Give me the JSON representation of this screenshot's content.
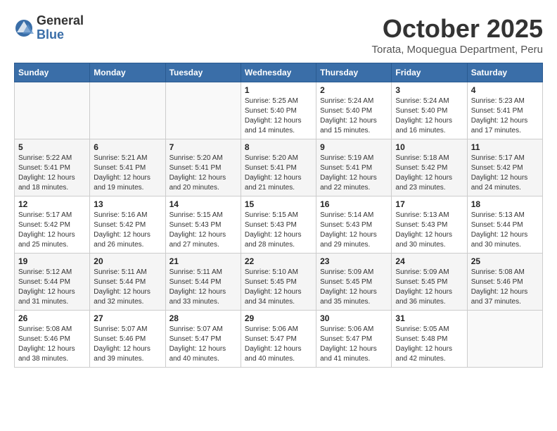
{
  "logo": {
    "general": "General",
    "blue": "Blue"
  },
  "header": {
    "month": "October 2025",
    "location": "Torata, Moquegua Department, Peru"
  },
  "days_of_week": [
    "Sunday",
    "Monday",
    "Tuesday",
    "Wednesday",
    "Thursday",
    "Friday",
    "Saturday"
  ],
  "weeks": [
    [
      {
        "day": "",
        "info": ""
      },
      {
        "day": "",
        "info": ""
      },
      {
        "day": "",
        "info": ""
      },
      {
        "day": "1",
        "info": "Sunrise: 5:25 AM\nSunset: 5:40 PM\nDaylight: 12 hours and 14 minutes."
      },
      {
        "day": "2",
        "info": "Sunrise: 5:24 AM\nSunset: 5:40 PM\nDaylight: 12 hours and 15 minutes."
      },
      {
        "day": "3",
        "info": "Sunrise: 5:24 AM\nSunset: 5:40 PM\nDaylight: 12 hours and 16 minutes."
      },
      {
        "day": "4",
        "info": "Sunrise: 5:23 AM\nSunset: 5:41 PM\nDaylight: 12 hours and 17 minutes."
      }
    ],
    [
      {
        "day": "5",
        "info": "Sunrise: 5:22 AM\nSunset: 5:41 PM\nDaylight: 12 hours and 18 minutes."
      },
      {
        "day": "6",
        "info": "Sunrise: 5:21 AM\nSunset: 5:41 PM\nDaylight: 12 hours and 19 minutes."
      },
      {
        "day": "7",
        "info": "Sunrise: 5:20 AM\nSunset: 5:41 PM\nDaylight: 12 hours and 20 minutes."
      },
      {
        "day": "8",
        "info": "Sunrise: 5:20 AM\nSunset: 5:41 PM\nDaylight: 12 hours and 21 minutes."
      },
      {
        "day": "9",
        "info": "Sunrise: 5:19 AM\nSunset: 5:41 PM\nDaylight: 12 hours and 22 minutes."
      },
      {
        "day": "10",
        "info": "Sunrise: 5:18 AM\nSunset: 5:42 PM\nDaylight: 12 hours and 23 minutes."
      },
      {
        "day": "11",
        "info": "Sunrise: 5:17 AM\nSunset: 5:42 PM\nDaylight: 12 hours and 24 minutes."
      }
    ],
    [
      {
        "day": "12",
        "info": "Sunrise: 5:17 AM\nSunset: 5:42 PM\nDaylight: 12 hours and 25 minutes."
      },
      {
        "day": "13",
        "info": "Sunrise: 5:16 AM\nSunset: 5:42 PM\nDaylight: 12 hours and 26 minutes."
      },
      {
        "day": "14",
        "info": "Sunrise: 5:15 AM\nSunset: 5:43 PM\nDaylight: 12 hours and 27 minutes."
      },
      {
        "day": "15",
        "info": "Sunrise: 5:15 AM\nSunset: 5:43 PM\nDaylight: 12 hours and 28 minutes."
      },
      {
        "day": "16",
        "info": "Sunrise: 5:14 AM\nSunset: 5:43 PM\nDaylight: 12 hours and 29 minutes."
      },
      {
        "day": "17",
        "info": "Sunrise: 5:13 AM\nSunset: 5:43 PM\nDaylight: 12 hours and 30 minutes."
      },
      {
        "day": "18",
        "info": "Sunrise: 5:13 AM\nSunset: 5:44 PM\nDaylight: 12 hours and 30 minutes."
      }
    ],
    [
      {
        "day": "19",
        "info": "Sunrise: 5:12 AM\nSunset: 5:44 PM\nDaylight: 12 hours and 31 minutes."
      },
      {
        "day": "20",
        "info": "Sunrise: 5:11 AM\nSunset: 5:44 PM\nDaylight: 12 hours and 32 minutes."
      },
      {
        "day": "21",
        "info": "Sunrise: 5:11 AM\nSunset: 5:44 PM\nDaylight: 12 hours and 33 minutes."
      },
      {
        "day": "22",
        "info": "Sunrise: 5:10 AM\nSunset: 5:45 PM\nDaylight: 12 hours and 34 minutes."
      },
      {
        "day": "23",
        "info": "Sunrise: 5:09 AM\nSunset: 5:45 PM\nDaylight: 12 hours and 35 minutes."
      },
      {
        "day": "24",
        "info": "Sunrise: 5:09 AM\nSunset: 5:45 PM\nDaylight: 12 hours and 36 minutes."
      },
      {
        "day": "25",
        "info": "Sunrise: 5:08 AM\nSunset: 5:46 PM\nDaylight: 12 hours and 37 minutes."
      }
    ],
    [
      {
        "day": "26",
        "info": "Sunrise: 5:08 AM\nSunset: 5:46 PM\nDaylight: 12 hours and 38 minutes."
      },
      {
        "day": "27",
        "info": "Sunrise: 5:07 AM\nSunset: 5:46 PM\nDaylight: 12 hours and 39 minutes."
      },
      {
        "day": "28",
        "info": "Sunrise: 5:07 AM\nSunset: 5:47 PM\nDaylight: 12 hours and 40 minutes."
      },
      {
        "day": "29",
        "info": "Sunrise: 5:06 AM\nSunset: 5:47 PM\nDaylight: 12 hours and 40 minutes."
      },
      {
        "day": "30",
        "info": "Sunrise: 5:06 AM\nSunset: 5:47 PM\nDaylight: 12 hours and 41 minutes."
      },
      {
        "day": "31",
        "info": "Sunrise: 5:05 AM\nSunset: 5:48 PM\nDaylight: 12 hours and 42 minutes."
      },
      {
        "day": "",
        "info": ""
      }
    ]
  ]
}
